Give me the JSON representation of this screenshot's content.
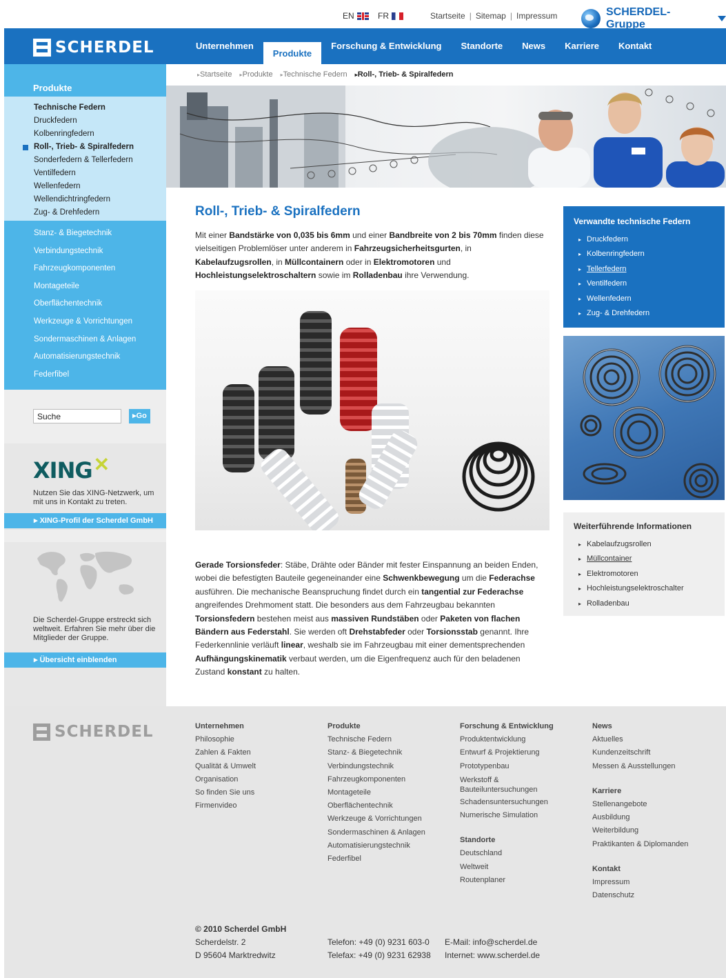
{
  "topbar": {
    "lang_en": "EN",
    "lang_fr": "FR",
    "links": [
      "Startseite",
      "Sitemap",
      "Impressum"
    ],
    "group_label": "SCHERDEL-Gruppe"
  },
  "header": {
    "logo_text": "SCHERDEL",
    "nav": [
      "Unternehmen",
      "Produkte",
      "Forschung & Entwicklung",
      "Standorte",
      "News",
      "Karriere",
      "Kontakt"
    ],
    "active_nav": "Produkte",
    "brand_color": "#1a71c0",
    "accent_color": "#4db5e8"
  },
  "sidebar": {
    "section_title": "Produkte",
    "sub_items": [
      "Technische Federn",
      "Druckfedern",
      "Kolbenringfedern",
      "Roll-, Trieb- & Spiralfedern",
      "Sonderfedern & Tellerfedern",
      "Ventilfedern",
      "Wellenfedern",
      "Wellendichtringfedern",
      "Zug- & Drehfedern"
    ],
    "main_items": [
      "Stanz- & Biegetechnik",
      "Verbindungstechnik",
      "Fahrzeugkomponenten",
      "Montageteile",
      "Oberflächentechnik",
      "Werkzeuge & Vorrichtungen",
      "Sondermaschinen & Anlagen",
      "Automatisierungstechnik",
      "Federfibel"
    ],
    "search": {
      "value": "Suche",
      "button": "Go"
    },
    "xing": {
      "logo": "XING",
      "text": "Nutzen Sie das XING-Netzwerk, um mit uns in Kontakt zu treten.",
      "link": "XING-Profil der Scherdel GmbH"
    },
    "world": {
      "text": "Die Scherdel-Gruppe erstreckt sich weltweit. Erfahren Sie mehr über die Mitglieder der Gruppe.",
      "link": "Übersicht einblenden"
    }
  },
  "breadcrumb": [
    "Startseite",
    "Produkte",
    "Technische Federn",
    "Roll-, Trieb- & Spiralfedern"
  ],
  "content": {
    "title": "Roll-, Trieb- & Spiralfedern",
    "intro": [
      {
        "t": "Mit einer ",
        "b": false
      },
      {
        "t": "Bandstärke von 0,035 bis 6mm",
        "b": true
      },
      {
        "t": " und einer ",
        "b": false
      },
      {
        "t": "Bandbreite von 2 bis 70mm",
        "b": true
      },
      {
        "t": " finden diese vielseitigen Problemlöser unter anderem in ",
        "b": false
      },
      {
        "t": "Fahrzeugsicherheitsgurten",
        "b": true
      },
      {
        "t": ", in ",
        "b": false
      },
      {
        "t": "Kabelaufzugsrollen",
        "b": true
      },
      {
        "t": ", in ",
        "b": false
      },
      {
        "t": "Müllcontainern",
        "b": true
      },
      {
        "t": " oder in ",
        "b": false
      },
      {
        "t": "Elektromotoren",
        "b": true
      },
      {
        "t": " und ",
        "b": false
      },
      {
        "t": "Hochleistungselektroschaltern",
        "b": true
      },
      {
        "t": " sowie im ",
        "b": false
      },
      {
        "t": "Rolladenbau",
        "b": true
      },
      {
        "t": " ihre Verwendung.",
        "b": false
      }
    ],
    "body": [
      {
        "t": "Gerade Torsionsfeder",
        "b": true
      },
      {
        "t": ": Stäbe, Drähte oder Bänder mit fester Einspannung an beiden Enden, wobei die befestigten Bauteile gegeneinander eine ",
        "b": false
      },
      {
        "t": "Schwenkbewegung",
        "b": true
      },
      {
        "t": " um die ",
        "b": false
      },
      {
        "t": "Federachse",
        "b": true
      },
      {
        "t": " ausführen. Die mechanische Beanspruchung findet durch ein ",
        "b": false
      },
      {
        "t": "tangential zur Federachse",
        "b": true
      },
      {
        "t": " angreifendes Drehmoment statt. Die besonders aus dem Fahrzeugbau bekannten ",
        "b": false
      },
      {
        "t": "Torsionsfedern",
        "b": true
      },
      {
        "t": " bestehen meist aus ",
        "b": false
      },
      {
        "t": "massiven Rundstäben",
        "b": true
      },
      {
        "t": " oder ",
        "b": false
      },
      {
        "t": "Paketen von flachen Bändern aus Federstahl",
        "b": true
      },
      {
        "t": ". Sie werden oft ",
        "b": false
      },
      {
        "t": "Drehstabfeder",
        "b": true
      },
      {
        "t": " oder ",
        "b": false
      },
      {
        "t": "Torsionsstab",
        "b": true
      },
      {
        "t": " genannt. Ihre Federkennlinie verläuft ",
        "b": false
      },
      {
        "t": "linear",
        "b": true
      },
      {
        "t": ", weshalb sie im Fahrzeugbau mit einer dementsprechenden ",
        "b": false
      },
      {
        "t": "Aufhängungskinematik",
        "b": true
      },
      {
        "t": " verbaut werden, um die Eigenfrequenz auch für den beladenen Zustand ",
        "b": false
      },
      {
        "t": "konstant",
        "b": true
      },
      {
        "t": " zu halten.",
        "b": false
      }
    ]
  },
  "related": {
    "title": "Verwandte technische Federn",
    "items": [
      "Druckfedern",
      "Kolbenringfedern",
      "Tellerfedern",
      "Ventilfedern",
      "Wellenfedern",
      "Zug- & Drehfedern"
    ],
    "underlined": "Tellerfedern"
  },
  "info": {
    "title": "Weiterführende Informationen",
    "items": [
      "Kabelaufzugsrollen",
      "Müllcontainer",
      "Elektromotoren",
      "Hochleistungselektroschalter",
      "Rolladenbau"
    ],
    "underlined": "Müllcontainer"
  },
  "footer": {
    "logo_text": "SCHERDEL",
    "columns": [
      {
        "groups": [
          {
            "heading": "Unternehmen",
            "items": [
              "Philosophie",
              "Zahlen & Fakten",
              "Qualität & Umwelt",
              "Organisation",
              "So finden Sie uns",
              "Firmenvideo"
            ]
          }
        ]
      },
      {
        "groups": [
          {
            "heading": "Produkte",
            "items": [
              "Technische Federn",
              "Stanz- & Biegetechnik",
              "Verbindungstechnik",
              "Fahrzeugkomponenten",
              "Montageteile",
              "Oberflächentechnik",
              "Werkzeuge & Vorrichtungen",
              "Sondermaschinen & Anlagen",
              "Automatisierungstechnik",
              "Federfibel"
            ]
          }
        ]
      },
      {
        "groups": [
          {
            "heading": "Forschung & Entwicklung",
            "items": [
              "Produktentwicklung",
              "Entwurf & Projektierung",
              "Prototypenbau",
              "Werkstoff & Bauteiluntersuchungen",
              "Schadensuntersuchungen",
              "Numerische Simulation"
            ]
          },
          {
            "heading": "Standorte",
            "items": [
              "Deutschland",
              "Weltweit",
              "Routenplaner"
            ]
          }
        ]
      },
      {
        "groups": [
          {
            "heading": "News",
            "items": [
              "Aktuelles",
              "Kundenzeitschrift",
              "Messen & Ausstellungen"
            ]
          },
          {
            "heading": "Karriere",
            "items": [
              "Stellenangebote",
              "Ausbildung",
              "Weiterbildung",
              "Praktikanten & Diplomanden"
            ]
          },
          {
            "heading": "Kontakt",
            "items": [
              "Impressum",
              "Datenschutz"
            ]
          }
        ]
      }
    ],
    "copyright": "© 2010 Scherdel GmbH",
    "street": "Scherdelstr. 2",
    "city": "D 95604 Marktredwitz",
    "phone": "Telefon: +49 (0) 9231 603-0",
    "fax": "Telefax: +49 (0) 9231 62938",
    "email": "E-Mail: info@scherdel.de",
    "web": "Internet: www.scherdel.de"
  }
}
